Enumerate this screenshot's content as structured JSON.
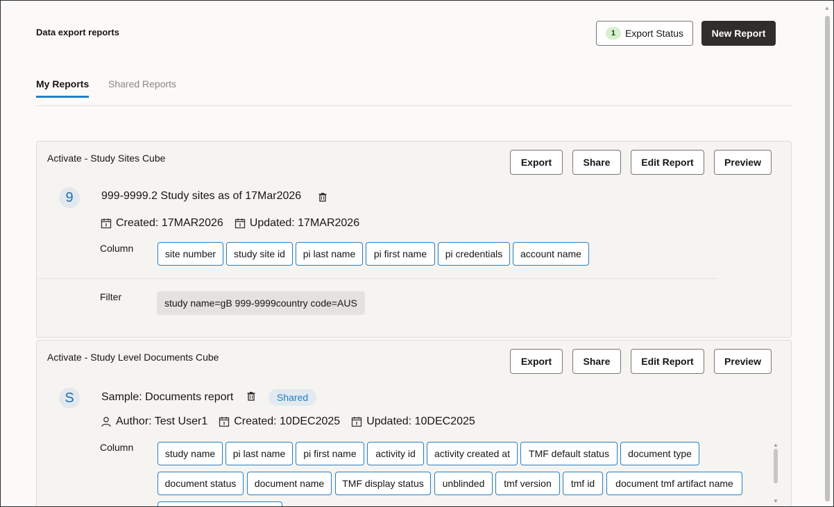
{
  "header": {
    "title": "Data export reports",
    "export_status_count": "1",
    "export_status_label": "Export Status",
    "new_report_label": "New Report"
  },
  "tabs": [
    {
      "label": "My Reports",
      "active": true
    },
    {
      "label": "Shared Reports",
      "active": false
    }
  ],
  "actions": {
    "export": "Export",
    "share": "Share",
    "edit": "Edit Report",
    "preview": "Preview"
  },
  "reports": [
    {
      "cube": "Activate - Study Sites Cube",
      "avatar": "9",
      "name": "999-9999.2 Study sites as of 17Mar2026",
      "created": "Created: 17MAR2026",
      "updated": "Updated: 17MAR2026",
      "column_label": "Column",
      "columns": [
        "site number",
        "study site id",
        "pi last name",
        "pi first name",
        "pi credentials",
        "account name"
      ],
      "filter_label": "Filter",
      "filter": "study name=gB 999-9999country code=AUS"
    },
    {
      "cube": "Activate - Study Level Documents Cube",
      "avatar": "S",
      "name": "Sample: Documents report",
      "shared_label": "Shared",
      "author": "Author: Test User1",
      "created": "Created: 10DEC2025",
      "updated": "Updated: 10DEC2025",
      "column_label": "Column",
      "columns_row1": [
        "study name",
        "pi last name",
        "pi first name",
        "activity id",
        "activity created at",
        "TMF default status",
        "document type"
      ],
      "columns_row2": [
        "document status",
        "document name",
        "TMF display status",
        "unblinded",
        "tmf version",
        "tmf id",
        "document tmf artifact name"
      ]
    }
  ],
  "colors": {
    "accent": "#227fc4",
    "dark_button": "#312d2a",
    "badge_bg": "#d7f0cf",
    "card_bg": "#f6f4f1"
  }
}
